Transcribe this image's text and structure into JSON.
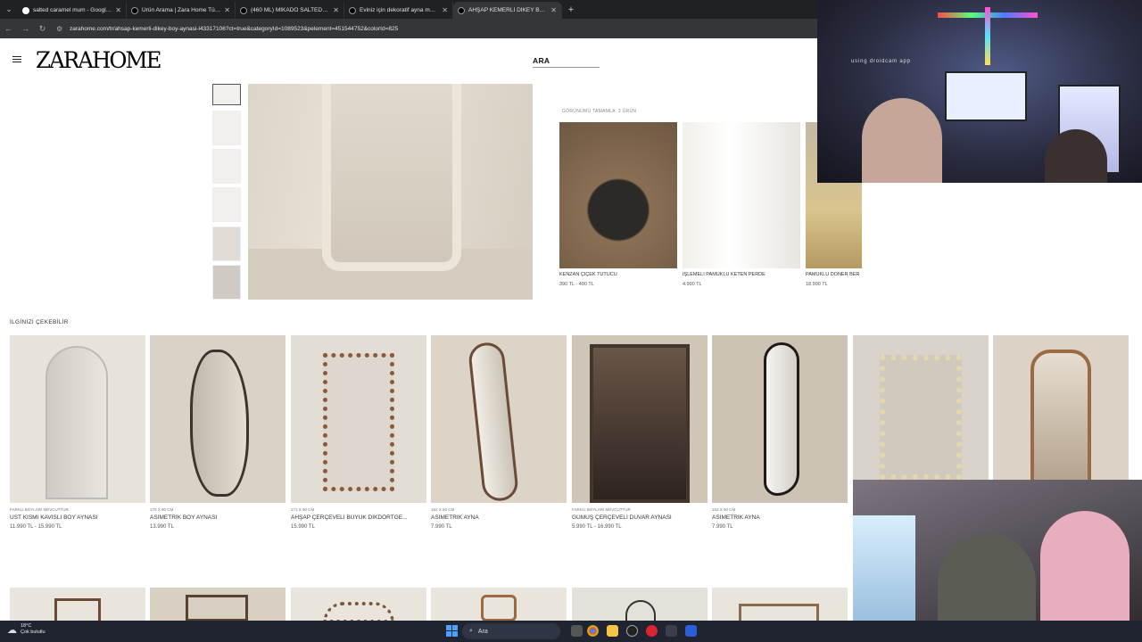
{
  "browser": {
    "tabs": [
      {
        "title": "salted caramel mum - Google'da",
        "icon": "google-icon",
        "active": false
      },
      {
        "title": "Ürün Arama | Zara Home Türkiye",
        "icon": "zara-icon",
        "active": false
      },
      {
        "title": "(460 ML) MİKADO SALTED CARA",
        "icon": "zara-icon",
        "active": false
      },
      {
        "title": "Eviniz için dekoratif ayna mode",
        "icon": "zara-icon",
        "active": false
      },
      {
        "title": "AHŞAP KEMERLİ DİKEY BOY AYN",
        "icon": "zara-icon",
        "active": true
      }
    ],
    "url": "zarahome.com/tr/ahsap-kemerli-dikey-boy-aynasi-l43317106?ct=true&categoryId=1089523&pelement=451544752&colorId=825"
  },
  "header": {
    "logo": "ZARAHOME",
    "search_label": "ARA"
  },
  "complete_the_look": {
    "title": "GÖRÜNÜMÜ TAMAMLA",
    "count": "3 ÜRÜN",
    "items": [
      {
        "name": "KENZAN ÇİÇEK TUTUCU",
        "price": "390 TL - 490 TL"
      },
      {
        "name": "İŞLEMELİ PAMUKLU KETEN PERDE",
        "price": "4.990 TL"
      },
      {
        "name": "PAMUKLU DÖNER BER",
        "price": "18.990 TL"
      }
    ]
  },
  "recommendations": {
    "title": "İLGİNİZİ ÇEKEBİLİR",
    "items": [
      {
        "sub": "FARKLI BOYLARI MEVCUTTUR",
        "name": "ÜST KISMI KAVİSLİ BOY AYNASI",
        "price": "11.990 TL - 15.990 TL"
      },
      {
        "sub": "170 X 90 CM",
        "name": "ASİMETRİK BOY AYNASI",
        "price": "13.990 TL"
      },
      {
        "sub": "171 X 90 CM",
        "name": "AHŞAP ÇERÇEVELİ BÜYÜK DİKDÖRTGE...",
        "price": "15.990 TL"
      },
      {
        "sub": "152 X 50 CM",
        "name": "ASİMETRİK AYNA",
        "price": "7.990 TL"
      },
      {
        "sub": "FARKLI BOYLARI MEVCUTTUR",
        "name": "GÜMÜŞ ÇERÇEVELİ DUVAR AYNASI",
        "price": "5.990 TL - 16.990 TL"
      },
      {
        "sub": "152 X 50 CM",
        "name": "ASİMETRİK AYNA",
        "price": "7.990 TL"
      },
      {
        "sub": "",
        "name": "",
        "price": ""
      },
      {
        "sub": "",
        "name": "",
        "price": ""
      }
    ]
  },
  "webcam": {
    "label": "using droidcam app"
  },
  "taskbar": {
    "weather_temp": "18°C",
    "weather_desc": "Çok bulutlu",
    "search_placeholder": "Ara"
  }
}
